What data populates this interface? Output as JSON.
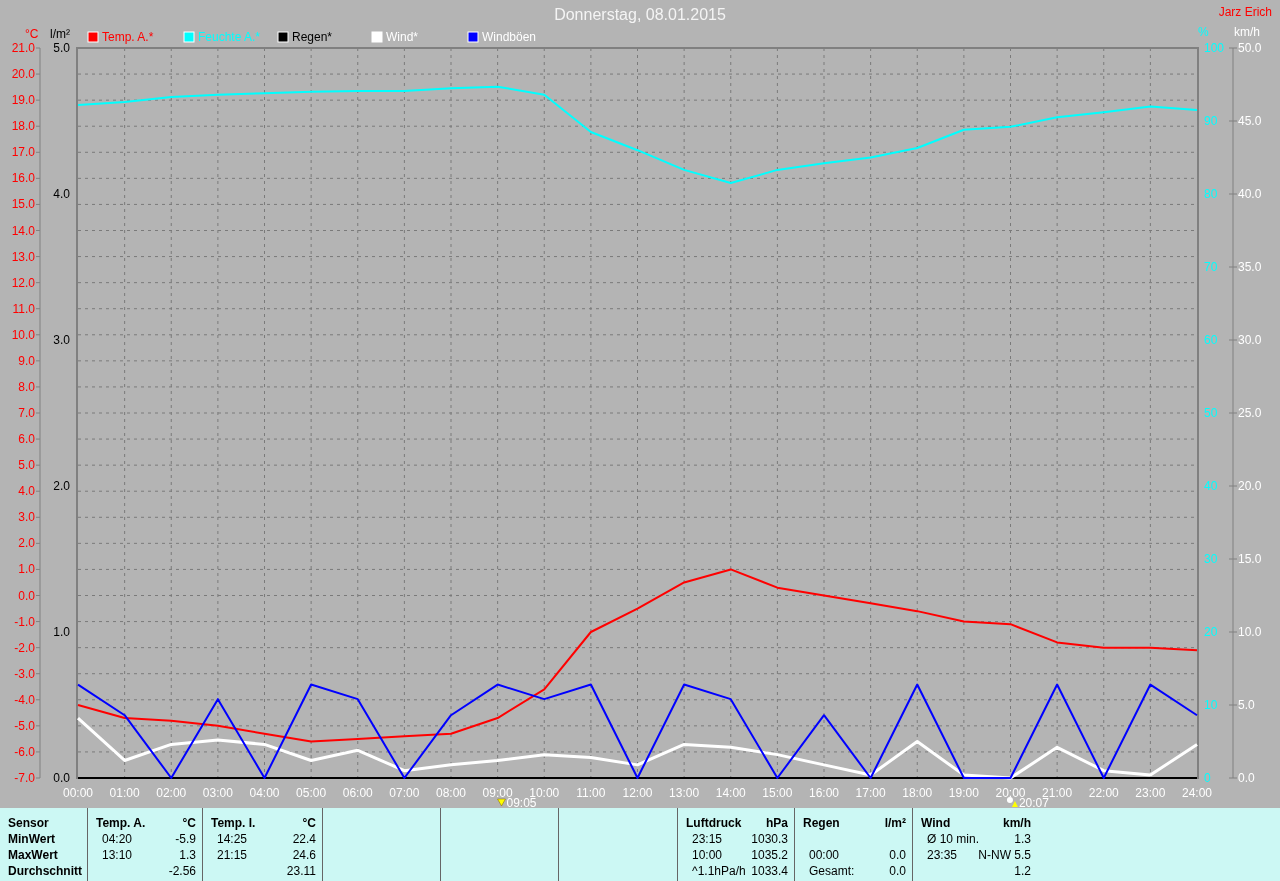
{
  "header": {
    "title": "Donnerstag, 08.01.2015",
    "user": "Jarz Erich"
  },
  "charts": [
    {
      "chart_data": {
        "type": "line",
        "ylabel": "°C",
        "ylim": [
          -7,
          21
        ],
        "xlim": [
          0,
          24
        ],
        "grid": true,
        "legend": "top",
        "x": [
          0,
          1,
          2,
          3,
          4,
          5,
          6,
          7,
          8,
          9,
          10,
          11,
          12,
          13,
          14,
          15,
          16,
          17,
          18,
          19,
          20,
          21,
          22,
          23,
          24
        ],
        "xticks": [
          {
            "value": 0,
            "label": "00:00"
          },
          {
            "value": 1,
            "label": "01:00"
          },
          {
            "value": 2,
            "label": "02:00"
          },
          {
            "value": 3,
            "label": "03:00"
          },
          {
            "value": 4,
            "label": "04:00"
          },
          {
            "value": 5,
            "label": "05:00"
          },
          {
            "value": 6,
            "label": "06:00"
          },
          {
            "value": 7,
            "label": "07:00"
          },
          {
            "value": 8,
            "label": "08:00"
          },
          {
            "value": 9,
            "label": "09:00"
          },
          {
            "value": 10,
            "label": "10:00"
          },
          {
            "value": 11,
            "label": "11:00"
          },
          {
            "value": 12,
            "label": "12:00"
          },
          {
            "value": 13,
            "label": "13:00"
          },
          {
            "value": 14,
            "label": "14:00"
          },
          {
            "value": 15,
            "label": "15:00"
          },
          {
            "value": 16,
            "label": "16:00"
          },
          {
            "value": 17,
            "label": "17:00"
          },
          {
            "value": 18,
            "label": "18:00"
          },
          {
            "value": 19,
            "label": "19:00"
          },
          {
            "value": 20,
            "label": "20:00"
          },
          {
            "value": 21,
            "label": "21:00"
          },
          {
            "value": 22,
            "label": "22:00"
          },
          {
            "value": 23,
            "label": "23:00"
          },
          {
            "value": 24,
            "label": "24:00"
          }
        ],
        "yticks": [
          {
            "value": 21,
            "label": "21.0"
          },
          {
            "value": 20,
            "label": "20.0"
          },
          {
            "value": 19,
            "label": "19.0"
          },
          {
            "value": 18,
            "label": "18.0"
          },
          {
            "value": 17,
            "label": "17.0"
          },
          {
            "value": 16,
            "label": "16.0"
          },
          {
            "value": 15,
            "label": "15.0"
          },
          {
            "value": 14,
            "label": "14.0"
          },
          {
            "value": 13,
            "label": "13.0"
          },
          {
            "value": 12,
            "label": "12.0"
          },
          {
            "value": 11,
            "label": "11.0"
          },
          {
            "value": 10,
            "label": "10.0"
          },
          {
            "value": 9,
            "label": "9.0"
          },
          {
            "value": 8,
            "label": "8.0"
          },
          {
            "value": 7,
            "label": "7.0"
          },
          {
            "value": 6,
            "label": "6.0"
          },
          {
            "value": 5,
            "label": "5.0"
          },
          {
            "value": 4,
            "label": "4.0"
          },
          {
            "value": 3,
            "label": "3.0"
          },
          {
            "value": 2,
            "label": "2.0"
          },
          {
            "value": 1,
            "label": "1.0"
          },
          {
            "value": 0,
            "label": "0.0"
          },
          {
            "value": -1,
            "label": "-1.0"
          },
          {
            "value": -2,
            "label": "-2.0"
          },
          {
            "value": -3,
            "label": "-3.0"
          },
          {
            "value": -4,
            "label": "-4.0"
          },
          {
            "value": -5,
            "label": "-5.0"
          },
          {
            "value": -6,
            "label": "-6.0"
          },
          {
            "value": -7,
            "label": "-7.0"
          }
        ],
        "series": [
          {
            "name": "Temp. A.*",
            "color": "#ff0000",
            "values": [
              -4.2,
              -4.7,
              -4.8,
              -5.0,
              -5.3,
              -5.6,
              -5.5,
              -5.4,
              -5.3,
              -4.7,
              -3.6,
              -1.4,
              -0.5,
              0.5,
              1.0,
              0.3,
              0.0,
              -0.3,
              -0.6,
              -1.0,
              -1.1,
              -1.8,
              -2.0,
              -2.0,
              -2.1
            ]
          }
        ]
      }
    },
    {
      "chart_data": {
        "type": "line",
        "ylabel": "%",
        "ylim": [
          0,
          100
        ],
        "xlim": [
          0,
          24
        ],
        "legend": "top",
        "x": [
          0,
          1,
          2,
          3,
          4,
          5,
          6,
          7,
          8,
          9,
          10,
          11,
          12,
          13,
          14,
          15,
          16,
          17,
          18,
          19,
          20,
          21,
          22,
          23,
          24
        ],
        "yticks": [
          100,
          90,
          80,
          70,
          60,
          50,
          40,
          30,
          20,
          10,
          0
        ],
        "series": [
          {
            "name": "Feuchte A.*",
            "color": "#00ffff",
            "values": [
              92.2,
              92.6,
              93.3,
              93.6,
              93.8,
              94.0,
              94.1,
              94.1,
              94.5,
              94.7,
              93.6,
              88.5,
              86.0,
              83.3,
              81.5,
              83.3,
              84.2,
              85.0,
              86.3,
              88.8,
              89.2,
              90.5,
              91.2,
              92.0,
              91.5
            ]
          }
        ]
      }
    },
    {
      "chart_data": {
        "type": "line",
        "ylabel": "l/m²",
        "ylim": [
          0,
          5
        ],
        "xlim": [
          0,
          24
        ],
        "legend": "top",
        "x": [
          0,
          1,
          2,
          3,
          4,
          5,
          6,
          7,
          8,
          9,
          10,
          11,
          12,
          13,
          14,
          15,
          16,
          17,
          18,
          19,
          20,
          21,
          22,
          23,
          24
        ],
        "yticks": [
          {
            "value": 5,
            "label": "5.0"
          },
          {
            "value": 4,
            "label": "4.0"
          },
          {
            "value": 3,
            "label": "3.0"
          },
          {
            "value": 2,
            "label": "2.0"
          },
          {
            "value": 1,
            "label": "1.0"
          },
          {
            "value": 0,
            "label": "0.0"
          }
        ],
        "series": [
          {
            "name": "Regen*",
            "color": "#000000",
            "values": [
              0,
              0,
              0,
              0,
              0,
              0,
              0,
              0,
              0,
              0,
              0,
              0,
              0,
              0,
              0,
              0,
              0,
              0,
              0,
              0,
              0,
              0,
              0,
              0,
              0
            ]
          }
        ]
      }
    },
    {
      "chart_data": {
        "type": "line",
        "ylabel": "km/h",
        "ylim": [
          0,
          50
        ],
        "xlim": [
          0,
          24
        ],
        "legend": "top",
        "x": [
          0,
          1,
          2,
          3,
          4,
          5,
          6,
          7,
          8,
          9,
          10,
          11,
          12,
          13,
          14,
          15,
          16,
          17,
          18,
          19,
          20,
          21,
          22,
          23,
          24
        ],
        "yticks": [
          {
            "value": 50,
            "label": "50.0"
          },
          {
            "value": 45,
            "label": "45.0"
          },
          {
            "value": 40,
            "label": "40.0"
          },
          {
            "value": 35,
            "label": "35.0"
          },
          {
            "value": 30,
            "label": "30.0"
          },
          {
            "value": 25,
            "label": "25.0"
          },
          {
            "value": 20,
            "label": "20.0"
          },
          {
            "value": 15,
            "label": "15.0"
          },
          {
            "value": 10,
            "label": "10.0"
          },
          {
            "value": 5,
            "label": "5.0"
          },
          {
            "value": 0,
            "label": "0.0"
          }
        ],
        "series": [
          {
            "name": "Wind*",
            "color": "#ffffff",
            "values": [
              4.1,
              1.2,
              2.3,
              2.6,
              2.3,
              1.2,
              1.9,
              0.5,
              0.9,
              1.2,
              1.6,
              1.4,
              0.9,
              2.3,
              2.1,
              1.6,
              0.9,
              0.2,
              2.5,
              0.2,
              0.0,
              2.1,
              0.5,
              0.2,
              2.3
            ]
          },
          {
            "name": "Windböen",
            "color": "#0000ff",
            "values": [
              6.4,
              4.3,
              0.0,
              5.4,
              0.0,
              6.4,
              5.4,
              0.0,
              4.3,
              6.4,
              5.4,
              6.4,
              0.0,
              6.4,
              5.4,
              0.0,
              4.3,
              0.0,
              6.4,
              0.0,
              0.0,
              6.4,
              0.0,
              6.4,
              4.3
            ]
          }
        ]
      }
    }
  ],
  "markers": [
    {
      "kind": "sunrise",
      "label": "09:05"
    },
    {
      "kind": "sunset",
      "label": "20:07"
    }
  ],
  "stats": {
    "row_labels": [
      "Sensor",
      "MinWert",
      "MaxWert",
      "Durchschnitt"
    ],
    "groups": [
      {
        "kind": "data",
        "name": "Temp. A.",
        "unit": "°C",
        "rows": [
          {
            "time": "04:20",
            "value": "-5.9"
          },
          {
            "time": "13:10",
            "value": "1.3"
          },
          {
            "time": null,
            "value": "-2.56"
          }
        ]
      },
      {
        "kind": "data",
        "name": "Temp. I.",
        "unit": "°C",
        "rows": [
          {
            "time": "14:25",
            "value": "22.4"
          },
          {
            "time": "21:15",
            "value": "24.6"
          },
          {
            "time": null,
            "value": "23.11"
          }
        ]
      },
      {
        "kind": "blank"
      },
      {
        "kind": "blank"
      },
      {
        "kind": "blank"
      },
      {
        "kind": "data",
        "name": "Luftdruck",
        "unit": "hPa",
        "rows": [
          {
            "time": "23:15",
            "value": "1030.3"
          },
          {
            "time": "10:00",
            "value": "1035.2"
          },
          {
            "time": "^1.1hPa/h",
            "value": "1033.4"
          }
        ]
      },
      {
        "kind": "data",
        "name": "Regen",
        "unit": "l/m²",
        "rows": [
          null,
          {
            "time": "00:00",
            "value": "0.0"
          },
          {
            "time": "Gesamt:",
            "value": "0.0"
          }
        ]
      },
      {
        "kind": "data",
        "name": "Wind",
        "unit": "km/h",
        "rows": [
          {
            "time": "Ø 10 min.",
            "value": "1.3"
          },
          {
            "time": "23:35",
            "value": "N-NW 5.5"
          },
          {
            "time": null,
            "value": "1.2"
          }
        ]
      }
    ]
  }
}
